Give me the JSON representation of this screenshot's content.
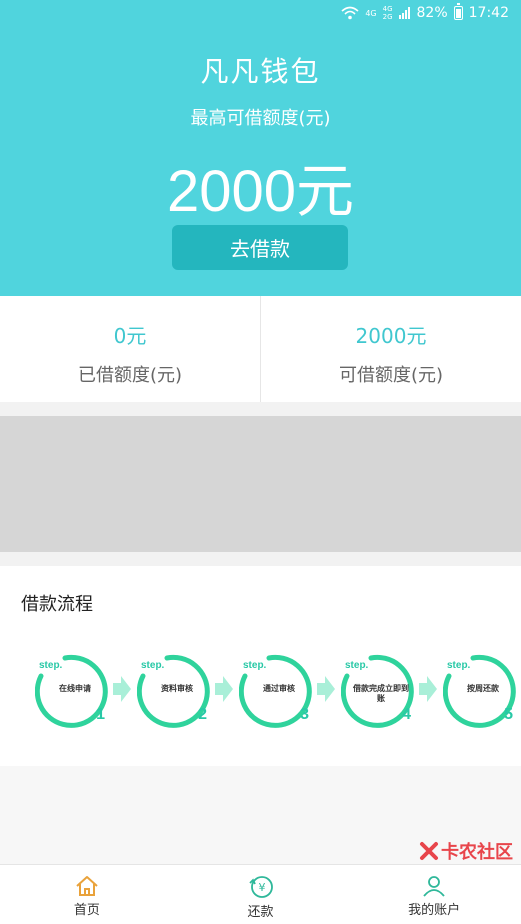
{
  "statusbar": {
    "network_top": "4G",
    "network_mid": "4G",
    "network_bottom": "2G",
    "battery": "82%",
    "time": "17:42"
  },
  "header": {
    "title": "凡凡钱包",
    "credit_label": "最高可借额度(元)",
    "credit_amount": "2000元",
    "borrow_button": "去借款"
  },
  "stats": [
    {
      "value": "0元",
      "label": "已借额度(元)"
    },
    {
      "value": "2000元",
      "label": "可借额度(元)"
    }
  ],
  "process": {
    "title": "借款流程",
    "steps": [
      {
        "word": "step.",
        "text": "在线申请",
        "num": "1"
      },
      {
        "word": "step.",
        "text": "资料审核",
        "num": "2"
      },
      {
        "word": "step.",
        "text": "通过审核",
        "num": "3"
      },
      {
        "word": "step.",
        "text": "借款完成立即到账",
        "num": "4"
      },
      {
        "word": "step.",
        "text": "按周还款",
        "num": "5"
      }
    ]
  },
  "tabbar": {
    "items": [
      {
        "label": "首页",
        "icon": "home-icon"
      },
      {
        "label": "还款",
        "icon": "repay-icon"
      },
      {
        "label": "我的账户",
        "icon": "account-icon"
      }
    ]
  },
  "watermark": "卡农社区",
  "colors": {
    "primary": "#50d4dd",
    "button": "#24b6be",
    "accent_green": "#28c8a6"
  }
}
